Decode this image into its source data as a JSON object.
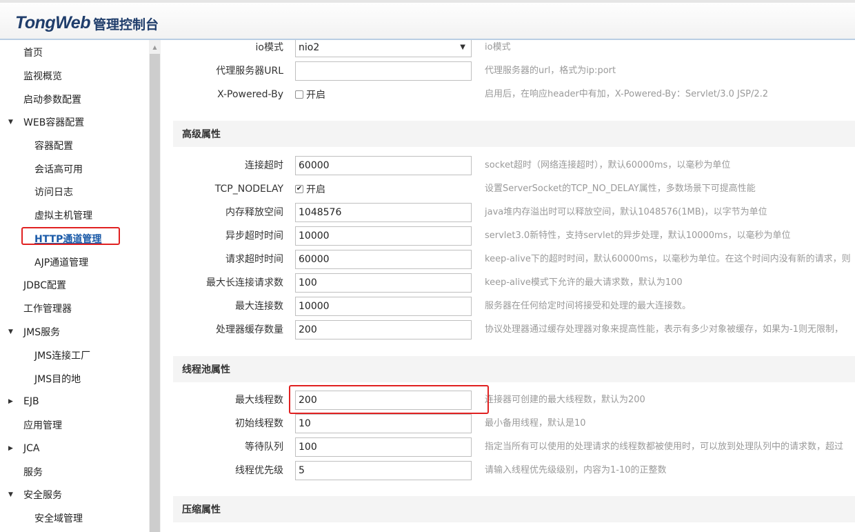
{
  "header": {
    "brand": "TongWeb",
    "subtitle": "管理控制台"
  },
  "sidebar": {
    "items": [
      {
        "label": "首页",
        "level": 1
      },
      {
        "label": "监视概览",
        "level": 1
      },
      {
        "label": "启动参数配置",
        "level": 1
      },
      {
        "label": "WEB容器配置",
        "level": 1,
        "expanded": true
      },
      {
        "label": "容器配置",
        "level": 2
      },
      {
        "label": "会话高可用",
        "level": 2
      },
      {
        "label": "访问日志",
        "level": 2
      },
      {
        "label": "虚拟主机管理",
        "level": 2
      },
      {
        "label": "HTTP通道管理",
        "level": 2,
        "active": true
      },
      {
        "label": "AJP通道管理",
        "level": 2
      },
      {
        "label": "JDBC配置",
        "level": 1
      },
      {
        "label": "工作管理器",
        "level": 1
      },
      {
        "label": "JMS服务",
        "level": 1,
        "expanded": true
      },
      {
        "label": "JMS连接工厂",
        "level": 2
      },
      {
        "label": "JMS目的地",
        "level": 2
      },
      {
        "label": "EJB",
        "level": 1,
        "collapsed": true
      },
      {
        "label": "应用管理",
        "level": 1
      },
      {
        "label": "JCA",
        "level": 1,
        "collapsed": true
      },
      {
        "label": "服务",
        "level": 1
      },
      {
        "label": "安全服务",
        "level": 1,
        "expanded": true
      },
      {
        "label": "安全域管理",
        "level": 2
      }
    ]
  },
  "top_rows": {
    "io_mode": {
      "label": "io模式",
      "value": "nio2",
      "desc": "io模式"
    },
    "proxy": {
      "label": "代理服务器URL",
      "value": "",
      "desc": "代理服务器的url，格式为ip:port"
    },
    "powered_by": {
      "label": "X-Powered-By",
      "checked": false,
      "check_label": "开启",
      "desc": "启用后，在响应header中有加，X-Powered-By：Servlet/3.0 JSP/2.2"
    }
  },
  "advanced": {
    "title": "高级属性",
    "rows": [
      {
        "label": "连接超时",
        "value": "60000",
        "desc": "socket超时（网络连接超时），默认60000ms，以毫秒为单位"
      },
      {
        "label": "TCP_NODELAY",
        "checkbox": true,
        "checked": true,
        "check_label": "开启",
        "desc": "设置ServerSocket的TCP_NO_DELAY属性，多数场景下可提高性能"
      },
      {
        "label": "内存释放空间",
        "value": "1048576",
        "desc": "java堆内存溢出时可以释放空间，默认1048576(1MB)，以字节为单位"
      },
      {
        "label": "异步超时时间",
        "value": "10000",
        "desc": "servlet3.0新特性，支持servlet的异步处理，默认10000ms，以毫秒为单位"
      },
      {
        "label": "请求超时时间",
        "value": "60000",
        "desc": "keep-alive下的超时时间，默认60000ms，以毫秒为单位。在这个时间内没有新的请求，则"
      },
      {
        "label": "最大长连接请求数",
        "value": "100",
        "desc": "keep-alive模式下允许的最大请求数，默认为100"
      },
      {
        "label": "最大连接数",
        "value": "10000",
        "desc": "服务器在任何给定时间将接受和处理的最大连接数。"
      },
      {
        "label": "处理器缓存数量",
        "value": "200",
        "desc": "协议处理器通过缓存处理器对象来提高性能，表示有多少对象被缓存，如果为-1则无限制，"
      }
    ]
  },
  "thread_pool": {
    "title": "线程池属性",
    "rows": [
      {
        "label": "最大线程数",
        "value": "200",
        "desc": "连接器可创建的最大线程数，默认为200"
      },
      {
        "label": "初始线程数",
        "value": "10",
        "desc": "最小备用线程，默认是10"
      },
      {
        "label": "等待队列",
        "value": "100",
        "desc": "指定当所有可以使用的处理请求的线程数都被使用时，可以放到处理队列中的请求数，超过"
      },
      {
        "label": "线程优先级",
        "value": "5",
        "desc": "请输入线程优先级级别，内容为1-10的正整数"
      }
    ]
  },
  "compression": {
    "title": "压缩属性"
  },
  "colors": {
    "accent": "#1a5aa8",
    "highlight": "#e02020",
    "desc_text": "#9a9a9a"
  }
}
